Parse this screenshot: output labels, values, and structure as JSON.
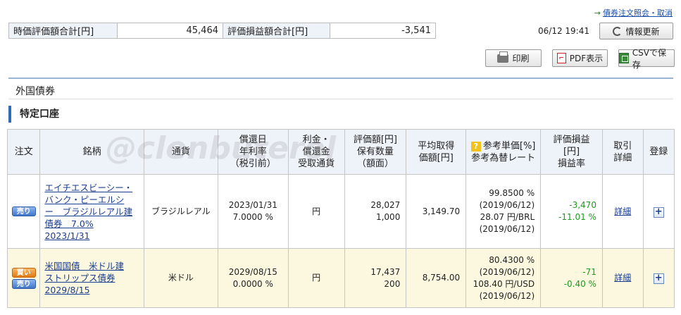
{
  "header": {
    "order_link": "債券注文照会・取消",
    "timestamp": "06/12 19:41",
    "refresh_label": "情報更新"
  },
  "summary": {
    "market_value_label": "時価評価額合計[円]",
    "market_value": "45,464",
    "pl_label": "評価損益額合計[円]",
    "pl_value": "-3,541"
  },
  "toolbar": {
    "print_label": "印刷",
    "pdf_label": "PDF表示",
    "csv_label": "CSVで保存"
  },
  "section": {
    "title": "外国債券",
    "account": "特定口座"
  },
  "watermark": "@clenbuterol",
  "table": {
    "headers": {
      "order": "注文",
      "name": "銘柄",
      "currency": "通貨",
      "maturity_l1": "償還日",
      "maturity_l2": "年利率",
      "maturity_l3": "（税引前）",
      "interest_l1": "利金・",
      "interest_l2": "償還金",
      "interest_l3": "受取通貨",
      "eval_l1": "評価額[円]",
      "eval_l2": "保有数量",
      "eval_l3": "（額面）",
      "avg_l1": "平均取得",
      "avg_l2": "価額[円]",
      "ref_l1": "参考単価[%]",
      "ref_l2": "参考為替レート",
      "pl_l1": "評価損益",
      "pl_l2": "[円]",
      "pl_l3": "損益率",
      "detail_l1": "取引",
      "detail_l2": "詳細",
      "register": "登録"
    },
    "rows": [
      {
        "badges": {
          "sell": "売り"
        },
        "name_l1": "エイチエスビーシー・",
        "name_l2": "バンク・ピーエルシ",
        "name_l3": "ー　ブラジルレアル建",
        "name_l4": "債券　7.0%",
        "name_l5": "2023/1/31",
        "currency": "ブラジルレアル",
        "maturity": "2023/01/31",
        "rate": "7.0000 %",
        "interest_currency": "円",
        "eval_amount": "28,027",
        "quantity": "1,000",
        "avg_price": "3,149.70",
        "ref_price": "99.8500 %",
        "ref_date1": "(2019/06/12)",
        "fx_rate": "28.07 円/BRL",
        "ref_date2": "(2019/06/12)",
        "pl": "-3,470",
        "pl_rate": "-11.01 %",
        "detail": "詳細",
        "register": "+"
      },
      {
        "badges": {
          "buy": "買い",
          "sell": "売り"
        },
        "name_l1": "米国国債　米ドル建",
        "name_l2": "ストリップス債券",
        "name_l3": "2029/8/15",
        "currency": "米ドル",
        "maturity": "2029/08/15",
        "rate": "0.0000 %",
        "interest_currency": "円",
        "eval_amount": "17,437",
        "quantity": "200",
        "avg_price": "8,754.00",
        "ref_price": "80.4300 %",
        "ref_date1": "(2019/06/12)",
        "fx_rate": "108.40 円/USD",
        "ref_date2": "(2019/06/12)",
        "pl": "-71",
        "pl_rate": "-0.40 %",
        "detail": "詳細",
        "register": "+"
      }
    ]
  },
  "icons": [
    "arrow-right-icon",
    "refresh-icon",
    "print-icon",
    "pdf-icon",
    "csv-icon",
    "question-icon",
    "plus-icon"
  ],
  "colors": {
    "accent": "#2f6db5",
    "positive": "#1e9a1e",
    "highlight_row": "#fbf8df",
    "header_bg": "#eef3fa"
  }
}
